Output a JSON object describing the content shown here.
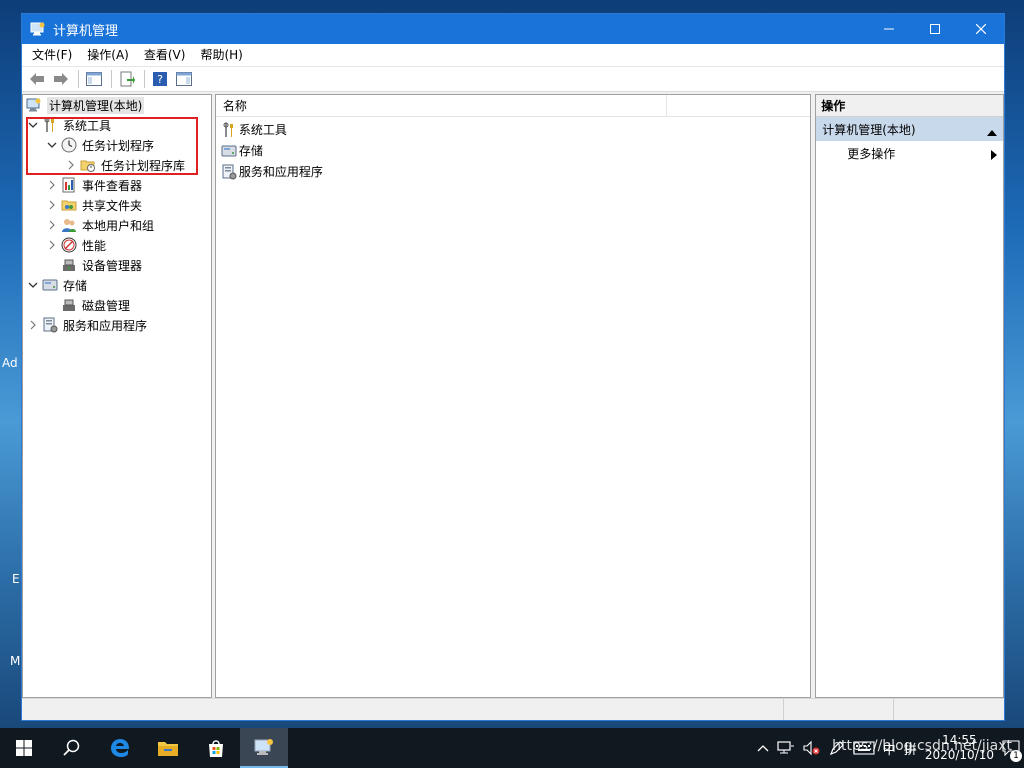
{
  "window": {
    "title": "计算机管理"
  },
  "menubar": {
    "items": [
      "文件(F)",
      "操作(A)",
      "查看(V)",
      "帮助(H)"
    ]
  },
  "tree": {
    "root": "计算机管理(本地)",
    "system_tools": "系统工具",
    "task_scheduler": "任务计划程序",
    "task_scheduler_library": "任务计划程序库",
    "event_viewer": "事件查看器",
    "shared_folders": "共享文件夹",
    "local_users_groups": "本地用户和组",
    "performance": "性能",
    "device_manager": "设备管理器",
    "storage": "存储",
    "disk_management": "磁盘管理",
    "services_apps": "服务和应用程序"
  },
  "list": {
    "header_name": "名称",
    "items": [
      "系统工具",
      "存储",
      "服务和应用程序"
    ]
  },
  "actions": {
    "title": "操作",
    "section": "计算机管理(本地)",
    "more": "更多操作"
  },
  "desktop": {
    "frag1": "Ad",
    "frag2": "E",
    "frag3": "M"
  },
  "taskbar": {
    "time": "14:55",
    "date": "2020/10/10",
    "ime_lang": "中",
    "ime_mode": "拼",
    "watermark": "https://blog.csdn.net/jiaxt",
    "notification_count": "1"
  },
  "colors": {
    "titlebar": "#1a73d9",
    "highlight_box": "#e02020",
    "action_section": "#c9d9ec"
  }
}
